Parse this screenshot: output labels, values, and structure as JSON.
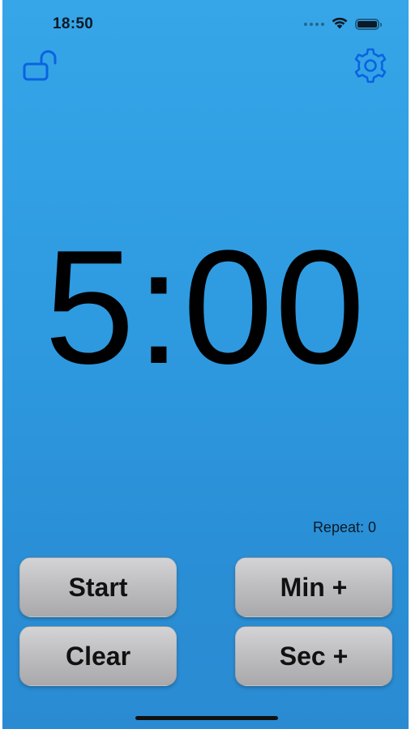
{
  "status_bar": {
    "time": "18:50",
    "wifi_icon": "wifi-icon",
    "battery_icon": "battery-icon"
  },
  "toolbar": {
    "lock_icon": "unlocked-padlock-icon",
    "settings_icon": "gear-icon"
  },
  "timer": {
    "display": "5:00"
  },
  "repeat": {
    "label": "Repeat: 0"
  },
  "buttons": {
    "start": "Start",
    "min_plus": "Min +",
    "clear": "Clear",
    "sec_plus": "Sec +"
  },
  "colors": {
    "background_top": "#36a6e8",
    "background_bottom": "#2a8bd2",
    "icon_accent": "#0a63e0",
    "button_fill": "#bdbdc0"
  }
}
